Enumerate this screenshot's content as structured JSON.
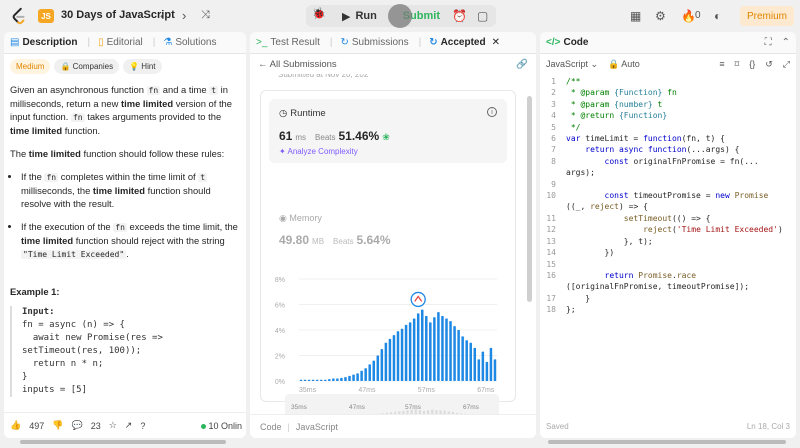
{
  "topbar": {
    "problem_title": "30 Days of JavaScript",
    "run_label": "Run",
    "submit_label": "Submit",
    "streak_count": "0",
    "premium_label": "Premium",
    "js_badge": "JS"
  },
  "left": {
    "tabs": [
      {
        "label": "Description",
        "active": true
      },
      {
        "label": "Editorial",
        "active": false
      },
      {
        "label": "Solutions",
        "active": false
      }
    ],
    "tags": [
      "Medium",
      "Companies",
      "Hint"
    ],
    "footer": {
      "likes": "497",
      "comments": "23",
      "online": "10 Onlin"
    },
    "example_title": "Example 1:",
    "example_lines": [
      "Input:",
      "fn = async (n) => {",
      "  await new Promise(res =>",
      "setTimeout(res, 100));",
      "  return n * n;",
      "}",
      "inputs = [5]"
    ]
  },
  "middle": {
    "tabs": [
      {
        "label": "Test Result",
        "active": false
      },
      {
        "label": "Submissions",
        "active": false
      },
      {
        "label": "Accepted",
        "active": true
      }
    ],
    "back_label": "All Submissions",
    "submitted_cut": "Submitted at Nov 20, 202",
    "runtime": {
      "label": "Runtime",
      "value": "61",
      "unit": "ms",
      "beats_label": "Beats",
      "beats_value": "51.46%",
      "analyze_label": "Analyze Complexity"
    },
    "memory": {
      "label": "Memory",
      "value": "49.80",
      "unit": "MB",
      "beats_label": "Beats",
      "beats_value": "5.64%"
    },
    "footer": {
      "code_label": "Code",
      "lang_label": "JavaScript"
    }
  },
  "right": {
    "tab_label": "Code",
    "language": "JavaScript",
    "auto_label": "Auto",
    "saved_label": "Saved",
    "position_label": "Ln 18, Col 3",
    "code_lines": [
      "/**",
      " * @param {Function} fn",
      " * @param {number} t",
      " * @return {Function}",
      " */",
      "var timeLimit = function(fn, t) {",
      "    return async function(...args) {",
      "        const originalFnPromise = fn(...",
      "args);",
      "",
      "        const timeoutPromise = new Promise",
      "((_, reject) => {",
      "            setTimeout(() => {",
      "                reject('Time Limit Exceeded')",
      "            }, t);",
      "        })",
      "",
      "        return Promise.race",
      "([originalFnPromise, timeoutPromise]);",
      "    }",
      "};"
    ],
    "line_numbers": [
      "1",
      "2",
      "3",
      "4",
      "5",
      "6",
      "7",
      "8",
      "",
      "9",
      "10",
      "",
      "11",
      "12",
      "13",
      "14",
      "15",
      "16",
      "",
      "17",
      "18"
    ]
  },
  "chart_data": {
    "type": "bar",
    "x_ticks": [
      "35ms",
      "47ms",
      "57ms",
      "67ms"
    ],
    "y_ticks": [
      "8%",
      "6%",
      "4%",
      "2%",
      "0%"
    ],
    "ylim": [
      0,
      8
    ],
    "values": [
      0.1,
      0.1,
      0.1,
      0.1,
      0.1,
      0.1,
      0.1,
      0.15,
      0.2,
      0.2,
      0.25,
      0.3,
      0.4,
      0.5,
      0.6,
      0.8,
      1.0,
      1.3,
      1.6,
      2.0,
      2.5,
      3.0,
      3.3,
      3.6,
      3.9,
      4.1,
      4.4,
      4.6,
      4.9,
      5.3,
      5.6,
      5.1,
      4.6,
      5.0,
      5.4,
      5.1,
      4.9,
      4.7,
      4.3,
      4.0,
      3.5,
      3.2,
      3.0,
      2.6,
      1.7,
      2.3,
      1.5,
      2.6,
      1.7
    ],
    "highlight_index": 29,
    "mini_ticks": [
      "35ms",
      "47ms",
      "57ms",
      "67ms"
    ]
  }
}
